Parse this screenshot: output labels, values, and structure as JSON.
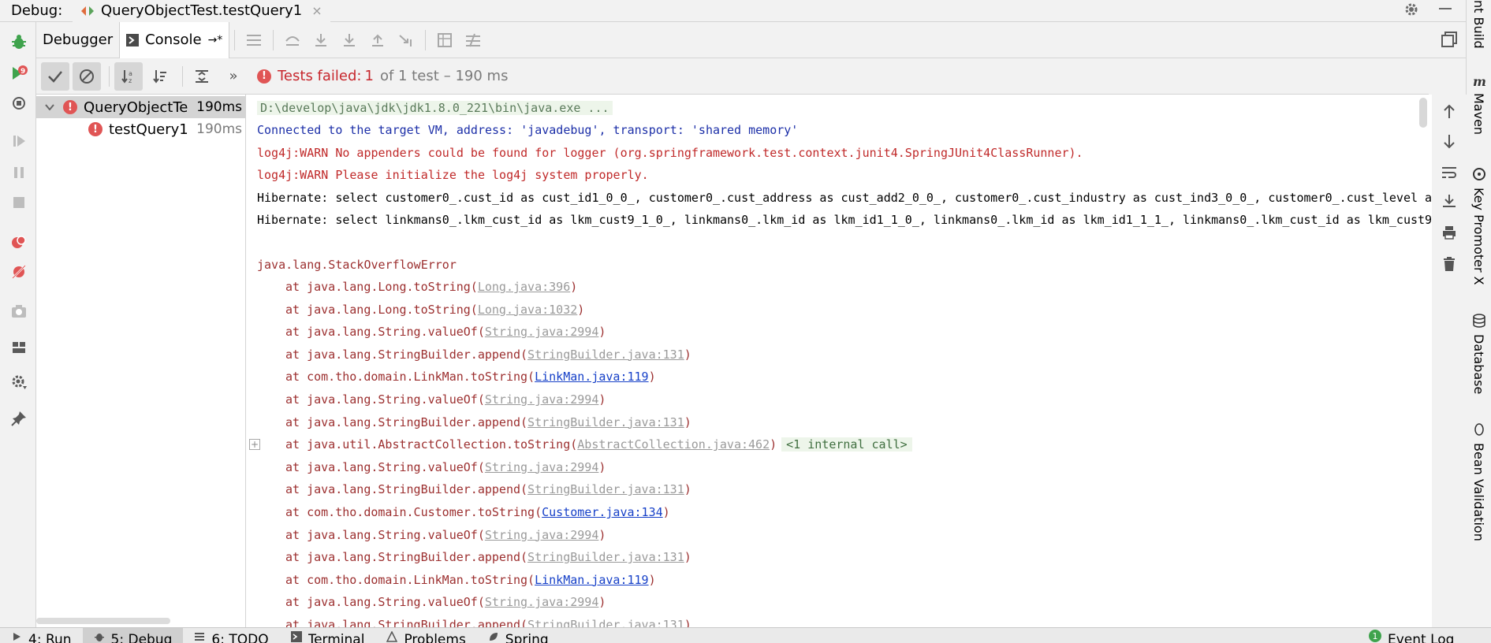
{
  "titlebar": {
    "debug_label": "Debug:",
    "session_tab": "QueryObjectTest.testQuery1",
    "close_glyph": "×"
  },
  "right_strip": {
    "ant_build": "nt Build",
    "maven": "Maven",
    "key_promoter": "Key Promoter X",
    "database": "Database",
    "bean_validation": "Bean Validation"
  },
  "tabs": {
    "debugger": "Debugger",
    "console": "Console",
    "console_glyph": "→*"
  },
  "test_toolbar": {
    "more_glyph": "»",
    "failed_prefix": "Tests failed:",
    "failed_count": "1",
    "of_total": "of 1 test",
    "duration": "– 190 ms"
  },
  "tree": {
    "items": [
      {
        "name": "QueryObjectTe",
        "time": "190ms",
        "status": "failed"
      },
      {
        "name": "testQuery1",
        "time": "190ms",
        "status": "failed"
      }
    ]
  },
  "console": {
    "cmd": "D:\\develop\\java\\jdk\\jdk1.8.0_221\\bin\\java.exe ...",
    "connected": "Connected to the target VM, address: 'javadebug', transport: 'shared memory'",
    "warn1": "log4j:WARN No appenders could be found for logger (org.springframework.test.context.junit4.SpringJUnit4ClassRunner).",
    "warn2": "log4j:WARN Please initialize the log4j system properly.",
    "hib1": "Hibernate: select customer0_.cust_id as cust_id1_0_0_, customer0_.cust_address as cust_add2_0_0_, customer0_.cust_industry as cust_ind3_0_0_, customer0_.cust_level as",
    "hib2": "Hibernate: select linkmans0_.lkm_cust_id as lkm_cust9_1_0_, linkmans0_.lkm_id as lkm_id1_1_0_, linkmans0_.lkm_id as lkm_id1_1_1_, linkmans0_.lkm_cust_id as lkm_cust9",
    "exception": "java.lang.StackOverflowError",
    "fold_glyph": "+",
    "internal_call": "<1 internal call>",
    "frames": [
      {
        "method": "at java.lang.Long.toString(",
        "link": "Long.java:396",
        "lib": true
      },
      {
        "method": "at java.lang.Long.toString(",
        "link": "Long.java:1032",
        "lib": true
      },
      {
        "method": "at java.lang.String.valueOf(",
        "link": "String.java:2994",
        "lib": true
      },
      {
        "method": "at java.lang.StringBuilder.append(",
        "link": "StringBuilder.java:131",
        "lib": true
      },
      {
        "method": "at com.tho.domain.LinkMan.toString(",
        "link": "LinkMan.java:119",
        "lib": false
      },
      {
        "method": "at java.lang.String.valueOf(",
        "link": "String.java:2994",
        "lib": true
      },
      {
        "method": "at java.lang.StringBuilder.append(",
        "link": "StringBuilder.java:131",
        "lib": true
      },
      {
        "method": "at java.util.AbstractCollection.toString(",
        "link": "AbstractCollection.java:462",
        "lib": true
      },
      {
        "method": "at java.lang.String.valueOf(",
        "link": "String.java:2994",
        "lib": true
      },
      {
        "method": "at java.lang.StringBuilder.append(",
        "link": "StringBuilder.java:131",
        "lib": true
      },
      {
        "method": "at com.tho.domain.Customer.toString(",
        "link": "Customer.java:134",
        "lib": false
      },
      {
        "method": "at java.lang.String.valueOf(",
        "link": "String.java:2994",
        "lib": true
      },
      {
        "method": "at java.lang.StringBuilder.append(",
        "link": "StringBuilder.java:131",
        "lib": true
      },
      {
        "method": "at com.tho.domain.LinkMan.toString(",
        "link": "LinkMan.java:119",
        "lib": false
      },
      {
        "method": "at java.lang.String.valueOf(",
        "link": "String.java:2994",
        "lib": true
      },
      {
        "method": "at java.lang.StringBuilder.append(",
        "link": "StringBuilder.java:131",
        "lib": true
      }
    ],
    "close_paren": ")"
  },
  "bottombar": {
    "run": "4: Run",
    "debug": "5: Debug",
    "todo": "6: TODO",
    "terminal": "Terminal",
    "problems": "Problems",
    "spring": "Spring",
    "event_log": "Event Log",
    "event_count": "1"
  },
  "colors": {
    "error": "#c7272d",
    "link": "#1640c8",
    "stack_text": "#9c2f2f",
    "connected_text": "#1c2fa8",
    "debug_green": "#3fa34d"
  }
}
